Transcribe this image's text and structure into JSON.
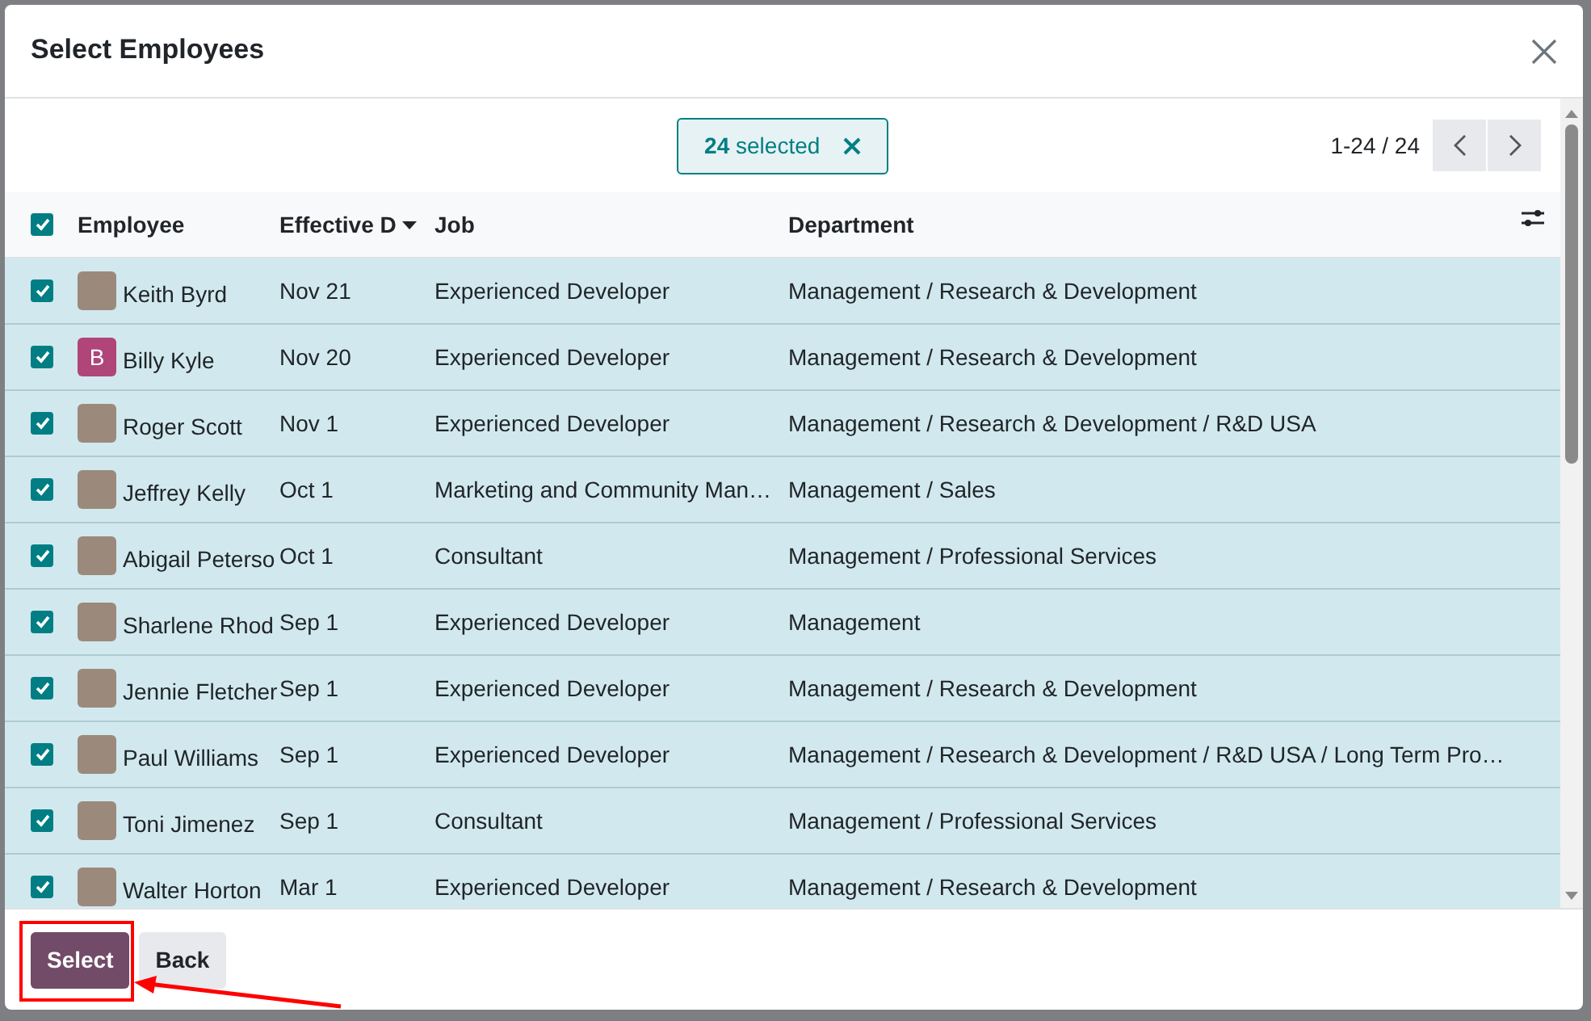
{
  "dialog": {
    "title": "Select Employees"
  },
  "selection": {
    "count": "24",
    "label": "selected"
  },
  "pager": {
    "range": "1-24 / 24"
  },
  "header_checkbox": {
    "checked": true
  },
  "columns": [
    {
      "label": "Employee",
      "sorted": false
    },
    {
      "label": "Effective D",
      "sorted": true
    },
    {
      "label": "Job",
      "sorted": false
    },
    {
      "label": "Department",
      "sorted": false
    }
  ],
  "rows": [
    {
      "selected": true,
      "employee": "Keith Byrd",
      "avatar": {
        "kind": "photo"
      },
      "effective_date": "Nov 21",
      "job": "Experienced Developer",
      "department": "Management / Research & Development"
    },
    {
      "selected": true,
      "employee": "Billy Kyle",
      "avatar": {
        "kind": "initial",
        "letter": "B",
        "color": "#b0457a"
      },
      "effective_date": "Nov 20",
      "job": "Experienced Developer",
      "department": "Management / Research & Development"
    },
    {
      "selected": true,
      "employee": "Roger Scott",
      "avatar": {
        "kind": "photo"
      },
      "effective_date": "Nov 1",
      "job": "Experienced Developer",
      "department": "Management / Research & Development / R&D USA"
    },
    {
      "selected": true,
      "employee": "Jeffrey Kelly",
      "avatar": {
        "kind": "photo"
      },
      "effective_date": "Oct 1",
      "job": "Marketing and Community Man…",
      "department": "Management / Sales"
    },
    {
      "selected": true,
      "employee": "Abigail Peterso",
      "avatar": {
        "kind": "photo"
      },
      "effective_date": "Oct 1",
      "job": "Consultant",
      "department": "Management / Professional Services"
    },
    {
      "selected": true,
      "employee": "Sharlene Rhod",
      "avatar": {
        "kind": "photo"
      },
      "effective_date": "Sep 1",
      "job": "Experienced Developer",
      "department": "Management"
    },
    {
      "selected": true,
      "employee": "Jennie Fletcher",
      "avatar": {
        "kind": "photo"
      },
      "effective_date": "Sep 1",
      "job": "Experienced Developer",
      "department": "Management / Research & Development"
    },
    {
      "selected": true,
      "employee": "Paul Williams",
      "avatar": {
        "kind": "photo"
      },
      "effective_date": "Sep 1",
      "job": "Experienced Developer",
      "department": "Management / Research & Development / R&D USA / Long Term Pro…"
    },
    {
      "selected": true,
      "employee": "Toni Jimenez",
      "avatar": {
        "kind": "photo"
      },
      "effective_date": "Sep 1",
      "job": "Consultant",
      "department": "Management / Professional Services"
    },
    {
      "selected": true,
      "employee": "Walter Horton",
      "avatar": {
        "kind": "photo"
      },
      "effective_date": "Mar 1",
      "job": "Experienced Developer",
      "department": "Management / Research & Development"
    }
  ],
  "buttons": [
    {
      "label": "Select",
      "kind": "primary"
    },
    {
      "label": "Back",
      "kind": "secondary"
    }
  ]
}
